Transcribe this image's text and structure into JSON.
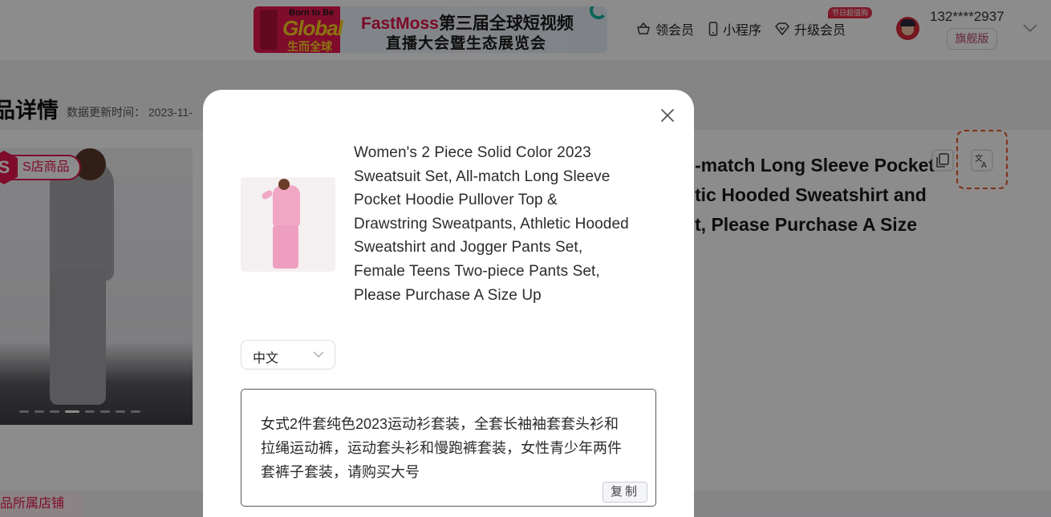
{
  "header": {
    "banner": {
      "logo_small": "Born to Be",
      "logo_big": "Global",
      "logo_cn": "生而全球",
      "title_brand": "FastMoss",
      "title_line1": "第三届全球短视频",
      "title_line2": "直播大会暨生态展览会"
    },
    "nav": {
      "vip_label": "领会员",
      "mini_program_label": "小程序",
      "upgrade_label": "升级会员",
      "promo_badge": "节日超值购"
    },
    "user": {
      "phone": "132****2937",
      "tier": "旗舰版"
    }
  },
  "background": {
    "page_title": "品详情",
    "update_label": "数据更新时间： 2023-11-",
    "shop_badge_letter": "S",
    "shop_badge_label": "S店商品",
    "product_title_visible": "-match Long Sleeve Pocket tic Hooded Sweatshirt and t, Please Purchase A Size",
    "shop_section_label": "品所属店铺"
  },
  "modal": {
    "product_title": "Women's 2 Piece Solid Color 2023 Sweatsuit Set, All-match Long Sleeve Pocket Hoodie Pullover Top & Drawstring Sweatpants, Athletic Hooded Sweatshirt and Jogger Pants Set, Female Teens Two-piece Pants Set, Please Purchase A Size Up",
    "language": "中文",
    "translation": "女式2件套纯色2023运动衫套装，全套长袖袖套套头衫和拉绳运动裤，运动套头衫和慢跑裤套装，女性青少年两件套裤子套装，请购买大号",
    "copy_label": "复制"
  },
  "colors": {
    "brand": "#e8174f",
    "translate_highlight": "#e8552a",
    "overlay": "rgba(0,0,0,0.45)"
  },
  "icons": [
    "basket-icon",
    "phone-icon",
    "diamond-icon",
    "chevron-down-icon",
    "copy-icon",
    "translate-icon",
    "close-icon"
  ]
}
